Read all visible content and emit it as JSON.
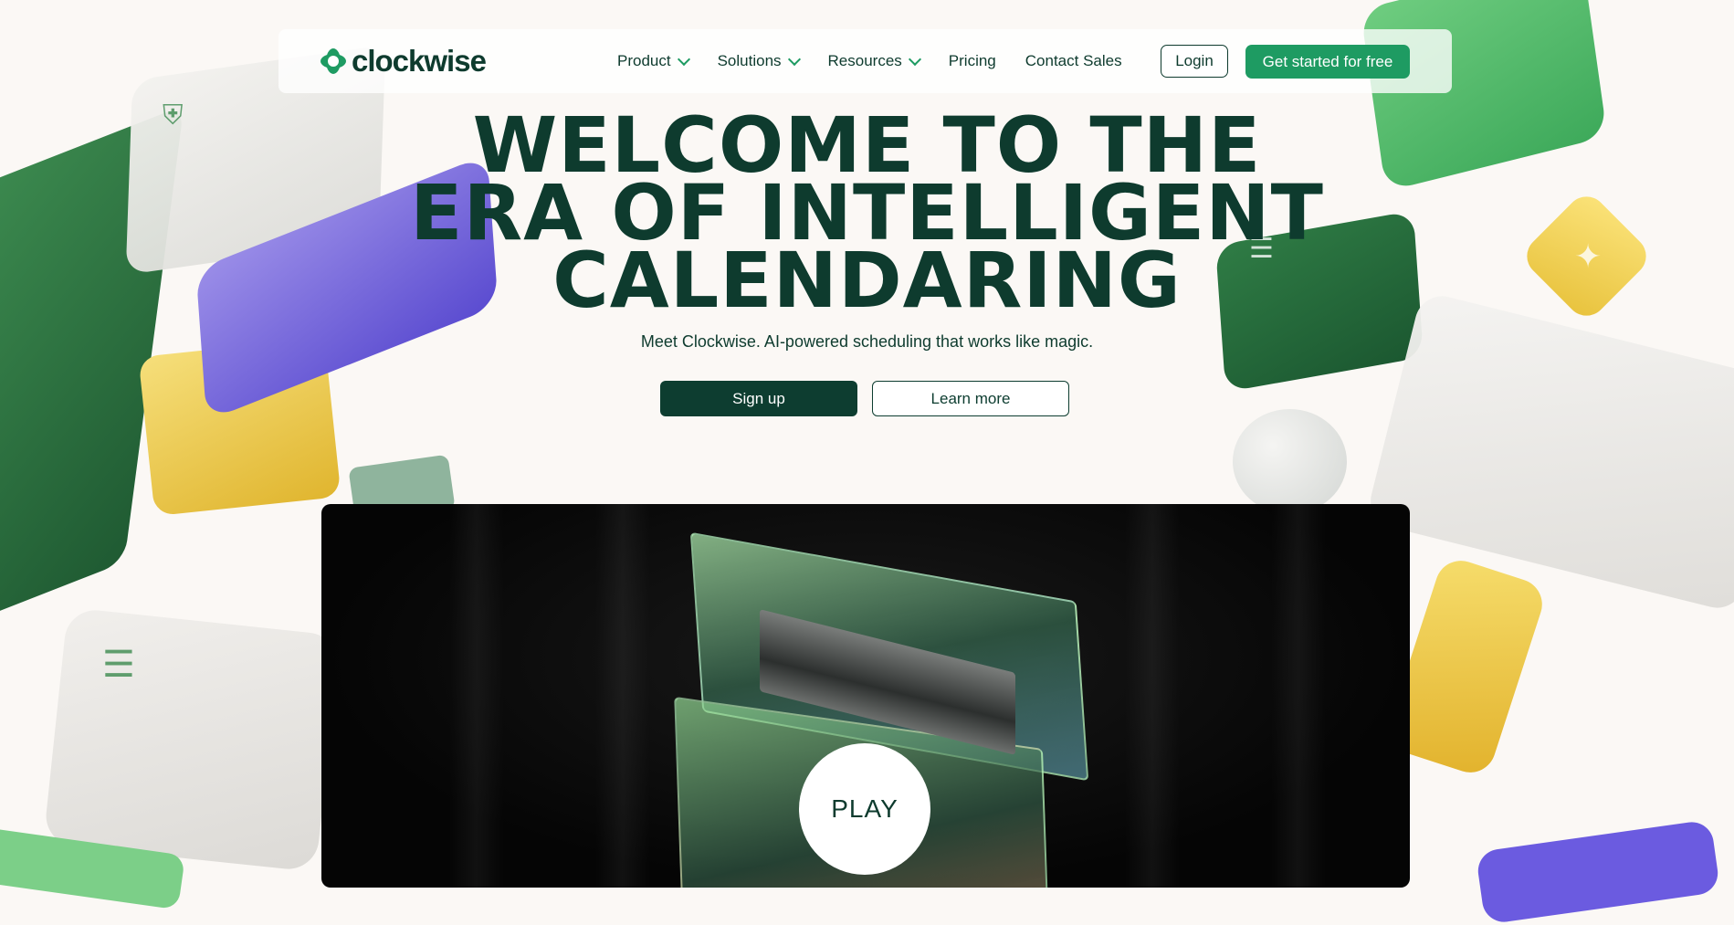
{
  "brand": {
    "name": "clockwise",
    "accent": "#1e9b62",
    "dark": "#0e3b2e"
  },
  "nav": {
    "items": [
      {
        "label": "Product",
        "has_dropdown": true
      },
      {
        "label": "Solutions",
        "has_dropdown": true
      },
      {
        "label": "Resources",
        "has_dropdown": true
      },
      {
        "label": "Pricing",
        "has_dropdown": false
      },
      {
        "label": "Contact Sales",
        "has_dropdown": false
      }
    ],
    "login_label": "Login",
    "cta_label": "Get started for free"
  },
  "hero": {
    "title_lines": [
      "WELCOME TO THE",
      "ERA OF INTELLIGENT",
      "CALENDARING"
    ],
    "subtitle": "Meet Clockwise. AI-powered scheduling that works like magic.",
    "primary_button": "Sign up",
    "secondary_button": "Learn more"
  },
  "video": {
    "play_label": "PLAY"
  }
}
